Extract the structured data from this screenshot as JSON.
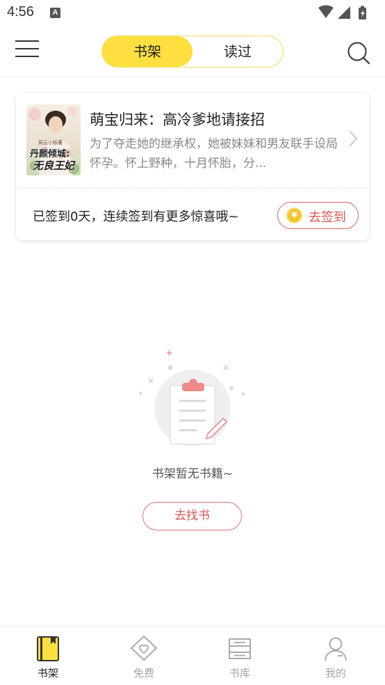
{
  "status_bar": {
    "time": "4:56",
    "notification_badge": "A"
  },
  "header": {
    "tabs": [
      {
        "label": "书架",
        "active": true
      },
      {
        "label": "读过",
        "active": false
      }
    ],
    "accent_color": "#fde03f"
  },
  "book_card": {
    "title": "萌宝归来：高冷爹地请接招",
    "description": "为了夺走她的继承权，她被妹妹和男友联手设局怀孕。怀上野种，十月怀胎，分...",
    "cover_author": "风云小妖著",
    "cover_title_top": "丹颜倾城:",
    "cover_title_bottom": "无良王妃",
    "signin_text": "已签到0天，连续签到有更多惊喜哦~",
    "signin_button": "去签到",
    "coin_symbol": "¥"
  },
  "empty_state": {
    "message": "书架暂无书籍~",
    "button": "去找书"
  },
  "bottom_nav": [
    {
      "label": "书架",
      "icon": "bookshelf-icon",
      "active": true
    },
    {
      "label": "免费",
      "icon": "free-tag-icon",
      "active": false
    },
    {
      "label": "书库",
      "icon": "library-stack-icon",
      "active": false
    },
    {
      "label": "我的",
      "icon": "profile-icon",
      "active": false
    }
  ],
  "colors": {
    "accent_yellow": "#fde03f",
    "accent_red": "#e05555"
  }
}
